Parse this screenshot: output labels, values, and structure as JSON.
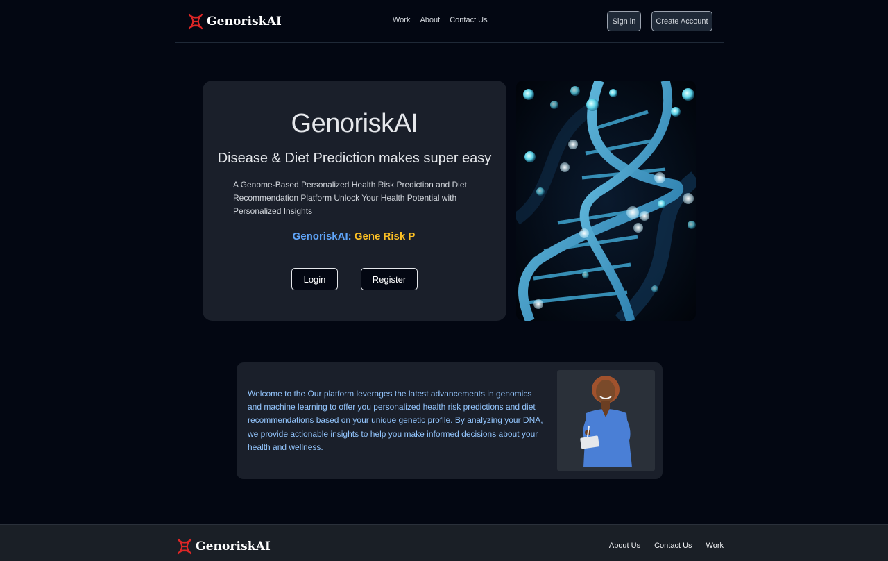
{
  "brand": {
    "name": "GenoriskAI",
    "logo_icon": "dna-helix-icon",
    "logo_color": "#dc2626"
  },
  "header": {
    "nav": [
      "Work",
      "About",
      "Contact Us"
    ],
    "signin_label": "Sign in",
    "create_account_label": "Create Account"
  },
  "hero": {
    "title": "GenoriskAI",
    "subtitle": "Disease & Diet Prediction makes super easy",
    "description": "A Genome-Based Personalized Health Risk Prediction and Diet Recommendation Platform Unlock Your Health Potential with Personalized Insights",
    "typing_prefix": "GenoriskAI:",
    "typing_word": "Gene Risk P",
    "login_label": "Login",
    "register_label": "Register",
    "image": "dna-double-helix-image"
  },
  "welcome": {
    "text": "Welcome to the Our platform leverages the latest advancements in genomics and machine learning to offer you personalized health risk predictions and diet recommendations based on your unique genetic profile. By analyzing your DNA, we provide actionable insights to help you make informed decisions about your health and wellness.",
    "image": "doctor-portrait-image"
  },
  "footer": {
    "brand": "GenoriskAI",
    "nav": [
      "About Us",
      "Contact Us",
      "Work"
    ]
  },
  "colors": {
    "background": "#030712",
    "card": "#1a1f2a",
    "accent_blue": "#60a5fa",
    "accent_yellow": "#fbbf24",
    "welcome_text": "#93c5fd"
  }
}
